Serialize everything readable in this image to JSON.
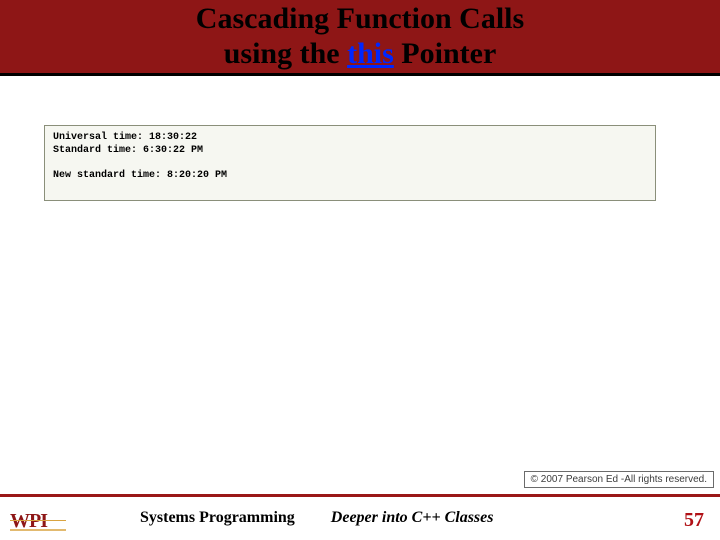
{
  "title": {
    "line1": "Cascading Function Calls",
    "line2_pre": "using the ",
    "line2_kw": "this",
    "line2_post": " Pointer"
  },
  "output": {
    "line1": "Universal time: 18:30:22",
    "line2": "Standard time: 6:30:22 PM",
    "blank": "",
    "line3": "New standard time: 8:20:20 PM"
  },
  "copyright": "© 2007 Pearson Ed -All rights reserved.",
  "footer": {
    "course": "Systems Programming",
    "topic": "Deeper into C++ Classes",
    "page": "57"
  },
  "logo": {
    "text": "WPI"
  }
}
